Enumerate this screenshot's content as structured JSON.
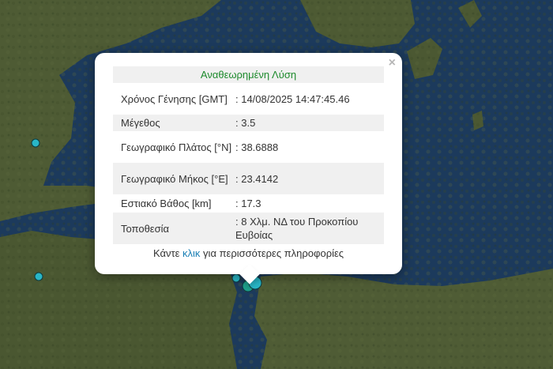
{
  "popup": {
    "close_glyph": "×",
    "title": "Αναθεωρημένη Λύση",
    "rows": [
      {
        "label": "Χρόνος Γένησης [GMT]",
        "value": ": 14/08/2025 14:47:45.46"
      },
      {
        "label": "Μέγεθος",
        "value": ": 3.5"
      },
      {
        "label": "Γεωγραφικό Πλάτος [°N]",
        "value": ": 38.6888"
      },
      {
        "label": "Γεωγραφικό Μήκος [°E]",
        "value": ": 23.4142"
      },
      {
        "label": "Εστιακό Βάθος [km]",
        "value": ": 17.3"
      },
      {
        "label": "Τοποθεσία",
        "value": ": 8 Χλμ. ΝΔ του Προκοπίου Ευβοίας"
      }
    ],
    "more_prefix": "Κάντε ",
    "more_link": "κλικ",
    "more_suffix": " για περισσότερες πληροφορίες"
  },
  "map": {
    "sea_color": "#1c3a5c",
    "land_color": "#4c5a33",
    "marker_color": "#29b6c6",
    "marker_stroke": "#0d3b40"
  }
}
